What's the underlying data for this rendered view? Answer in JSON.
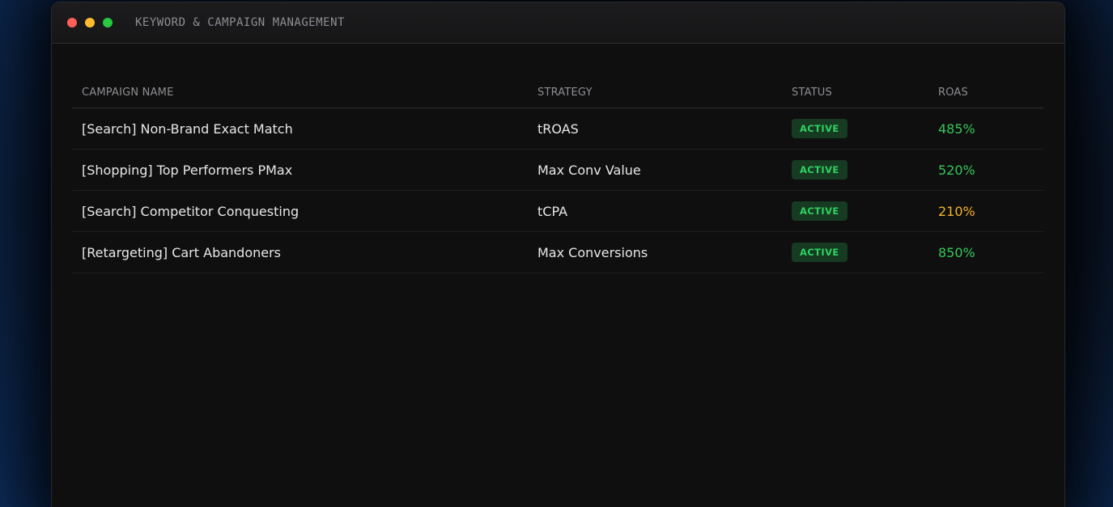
{
  "window": {
    "title": "KEYWORD & CAMPAIGN MANAGEMENT"
  },
  "table": {
    "headers": {
      "name": "CAMPAIGN NAME",
      "strategy": "STRATEGY",
      "status": "STATUS",
      "roas": "ROAS"
    },
    "rows": [
      {
        "name": "[Search] Non-Brand Exact Match",
        "strategy": "tROAS",
        "status": "ACTIVE",
        "roas": "485%",
        "roas_color": "#34c759"
      },
      {
        "name": "[Shopping] Top Performers PMax",
        "strategy": "Max Conv Value",
        "status": "ACTIVE",
        "roas": "520%",
        "roas_color": "#34c759"
      },
      {
        "name": "[Search] Competitor Conquesting",
        "strategy": "tCPA",
        "status": "ACTIVE",
        "roas": "210%",
        "roas_color": "#f5b325"
      },
      {
        "name": "[Retargeting] Cart Abandoners",
        "strategy": "Max Conversions",
        "status": "ACTIVE",
        "roas": "850%",
        "roas_color": "#34c759"
      }
    ]
  },
  "colors": {
    "accent_green": "#34c759",
    "warning_amber": "#f5b325",
    "badge_bg": "#163a22",
    "badge_text": "#2fd160"
  }
}
